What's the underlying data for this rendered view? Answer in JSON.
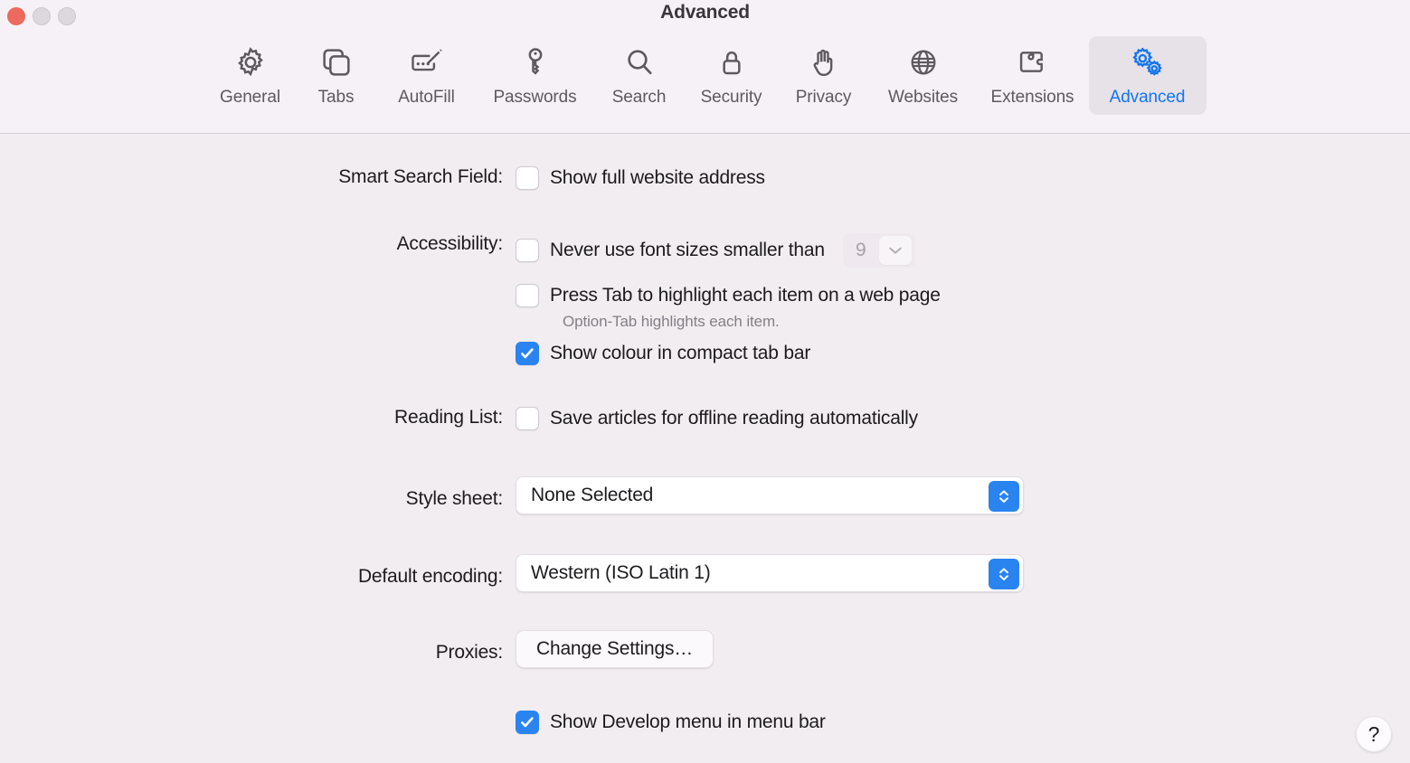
{
  "window": {
    "title": "Advanced",
    "traffic_lights": [
      {
        "name": "close",
        "color": "#ec6a5e"
      },
      {
        "name": "minimize",
        "color": "#dcd8dd"
      },
      {
        "name": "zoom",
        "color": "#dcd8dd"
      }
    ]
  },
  "toolbar": {
    "selected": "Advanced",
    "accent_color": "#1276f0",
    "selected_bg": "#e7e1e8",
    "items": [
      {
        "label": "General",
        "icon": "gear-icon"
      },
      {
        "label": "Tabs",
        "icon": "tabs-icon"
      },
      {
        "label": "AutoFill",
        "icon": "autofill-pencil-icon"
      },
      {
        "label": "Passwords",
        "icon": "key-icon"
      },
      {
        "label": "Search",
        "icon": "magnifier-icon"
      },
      {
        "label": "Security",
        "icon": "lock-icon"
      },
      {
        "label": "Privacy",
        "icon": "hand-icon"
      },
      {
        "label": "Websites",
        "icon": "globe-icon"
      },
      {
        "label": "Extensions",
        "icon": "puzzle-piece-icon"
      },
      {
        "label": "Advanced",
        "icon": "double-gear-icon"
      }
    ]
  },
  "settings": {
    "smart_search_field": {
      "label": "Smart Search Field:",
      "checkbox_label": "Show full website address",
      "checked": false
    },
    "accessibility": {
      "label": "Accessibility:",
      "min_font": {
        "checkbox_label": "Never use font sizes smaller than",
        "checked": false,
        "value": "9",
        "disabled": true
      },
      "tab_highlight": {
        "checkbox_label": "Press Tab to highlight each item on a web page",
        "checked": false,
        "hint": "Option-Tab highlights each item."
      },
      "compact_tab_colour": {
        "checkbox_label": "Show colour in compact tab bar",
        "checked": true
      }
    },
    "reading_list": {
      "label": "Reading List:",
      "checkbox_label": "Save articles for offline reading automatically",
      "checked": false
    },
    "style_sheet": {
      "label": "Style sheet:",
      "value": "None Selected"
    },
    "default_encoding": {
      "label": "Default encoding:",
      "value": "Western (ISO Latin 1)"
    },
    "proxies": {
      "label": "Proxies:",
      "button_label": "Change Settings…"
    },
    "develop_menu": {
      "checkbox_label": "Show Develop menu in menu bar",
      "checked": true
    }
  },
  "help": {
    "glyph": "?"
  }
}
